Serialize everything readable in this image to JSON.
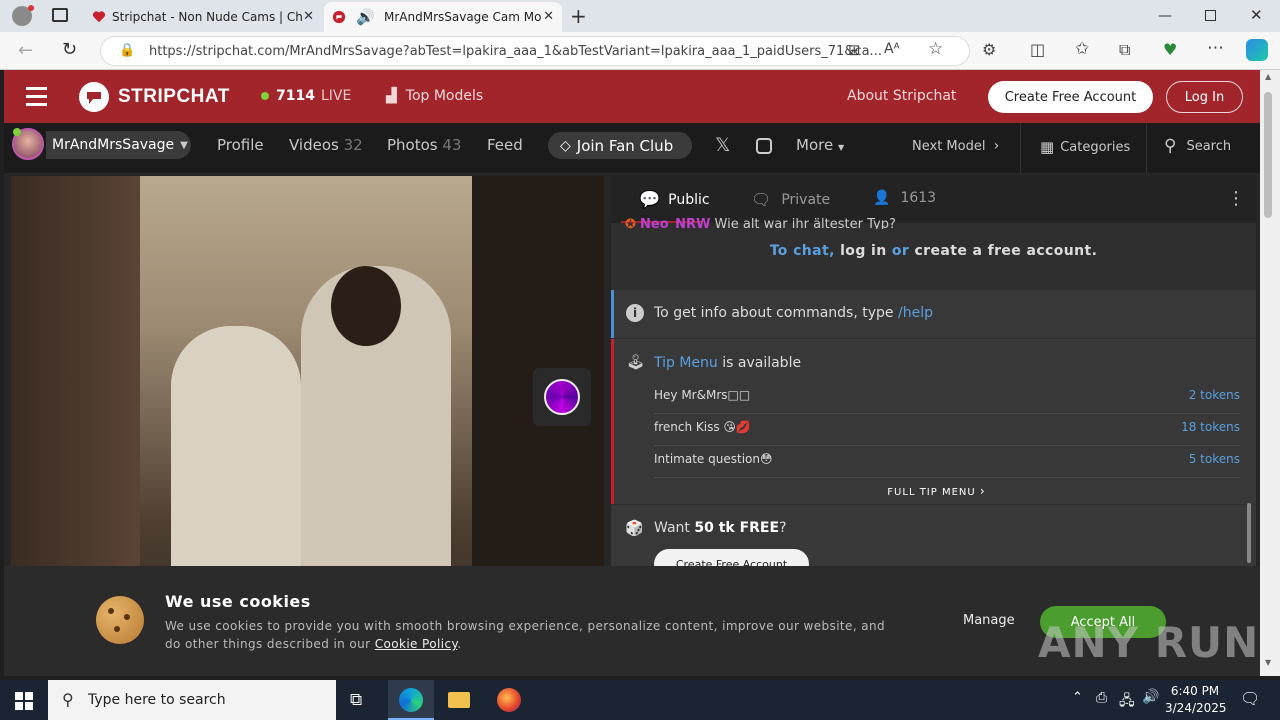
{
  "browser": {
    "tabs": [
      {
        "title": "Stripchat - Non Nude Cams | Ch",
        "active": false
      },
      {
        "title": "MrAndMrsSavage Cam Mo",
        "active": true
      }
    ],
    "url": "https://stripchat.com/MrAndMrsSavage?abTest=lpakira_aaa_1&abTestVariant=lpakira_aaa_1_paidUsers_71&ca..."
  },
  "site": {
    "logo": "STRIPCHAT",
    "live_count": "7114",
    "live_label": "LIVE",
    "top_models": "Top Models",
    "about": "About Stripchat",
    "create_account": "Create Free Account",
    "login": "Log In"
  },
  "model_nav": {
    "username": "MrAndMrsSavage",
    "profile": "Profile",
    "videos": "Videos",
    "videos_count": "32",
    "photos": "Photos",
    "photos_count": "43",
    "feed": "Feed",
    "fan_club": "Join Fan Club",
    "more": "More",
    "next_model": "Next Model",
    "categories": "Categories",
    "search": "Search"
  },
  "chat": {
    "tab_public": "Public",
    "tab_private": "Private",
    "viewers": "1613",
    "partial_user": "Neo_NRW",
    "partial_msg": "Wie alt war ihr ältester Typ?",
    "login_prompt": {
      "to_chat": "To chat,",
      "log_in": "log in",
      "or": "or",
      "create": "create a free account",
      "dot": "."
    },
    "help_text": "To get info about commands, type",
    "help_cmd": "/help",
    "tip_menu_link": "Tip Menu",
    "tip_menu_suffix": "is available",
    "tip_items": [
      {
        "label": "Hey Mr&Mrs□□",
        "price": "2 tokens"
      },
      {
        "label": "french Kiss 😘💋",
        "price": "18 tokens"
      },
      {
        "label": "Intimate question😳",
        "price": "5 tokens"
      }
    ],
    "full_tip_menu": "FULL TIP MENU",
    "want": "Want",
    "free_tk": "50 tk FREE",
    "qmark": "?",
    "create_btn": "Create Free Account"
  },
  "cookie": {
    "title": "We use cookies",
    "body": "We use cookies to provide you with smooth browsing experience, personalize content, improve our website, and do other things described in our",
    "policy_link": "Cookie Policy",
    "period": ".",
    "manage": "Manage",
    "accept": "Accept All"
  },
  "watermark": "ANY RUN",
  "taskbar": {
    "search_placeholder": "Type here to search",
    "time": "6:40 PM",
    "date": "3/24/2025"
  },
  "colors": {
    "brand_red": "#a2252b",
    "accent_blue": "#5aa0e0",
    "live_green": "#7fd23a",
    "accept_green": "#4a9d2e"
  }
}
